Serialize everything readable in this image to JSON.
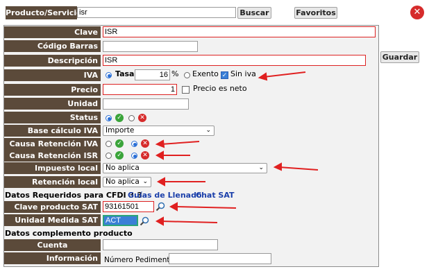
{
  "top": {
    "label": "Producto/Servicio",
    "search_value": "isr",
    "buscar": "Buscar",
    "favoritos": "Favoritos",
    "close_icon": "close-icon"
  },
  "guardar": "Guardar",
  "form": {
    "clave": {
      "label": "Clave",
      "value": "ISR"
    },
    "codigo_barras": {
      "label": "Código Barras",
      "value": ""
    },
    "descripcion": {
      "label": "Descripción",
      "value": "ISR"
    },
    "iva": {
      "label": "IVA",
      "tasa_label": "Tasa",
      "tasa_value": "16",
      "percent": "%",
      "exento_label": "Exento",
      "sin_iva_label": "Sin iva"
    },
    "precio": {
      "label": "Precio",
      "value": "1",
      "neto_label": "Precio es neto"
    },
    "unidad": {
      "label": "Unidad",
      "value": ""
    },
    "status": {
      "label": "Status"
    },
    "base_calculo": {
      "label": "Base cálculo IVA",
      "selected": "Importe"
    },
    "causa_ret_iva": {
      "label": "Causa Retención IVA"
    },
    "causa_ret_isr": {
      "label": "Causa Retención ISR"
    },
    "impuesto_local": {
      "label": "Impuesto local",
      "selected": "No aplica"
    },
    "retencion_local": {
      "label": "Retención local",
      "selected": "No aplica"
    },
    "cfdi": {
      "heading": "Datos Requeridos para CFDI 3.3",
      "guias": "Guías de Llenado",
      "chat": "Chat SAT"
    },
    "clave_producto_sat": {
      "label": "Clave producto SAT",
      "value": "93161501"
    },
    "unidad_medida_sat": {
      "label": "Unidad Medida SAT",
      "value": "ACT"
    },
    "complemento": {
      "heading": "Datos complemento producto"
    },
    "cuenta_predial": {
      "label": "Cuenta Predial/Catastral",
      "value": ""
    },
    "info_aduanera": {
      "label": "Información Aduanera",
      "pedimento_label": "Número Pedimento",
      "value": ""
    }
  },
  "colors": {
    "label_bg": "#5b4a3a",
    "annotation_red": "#e02020",
    "link": "#1a3faa"
  }
}
